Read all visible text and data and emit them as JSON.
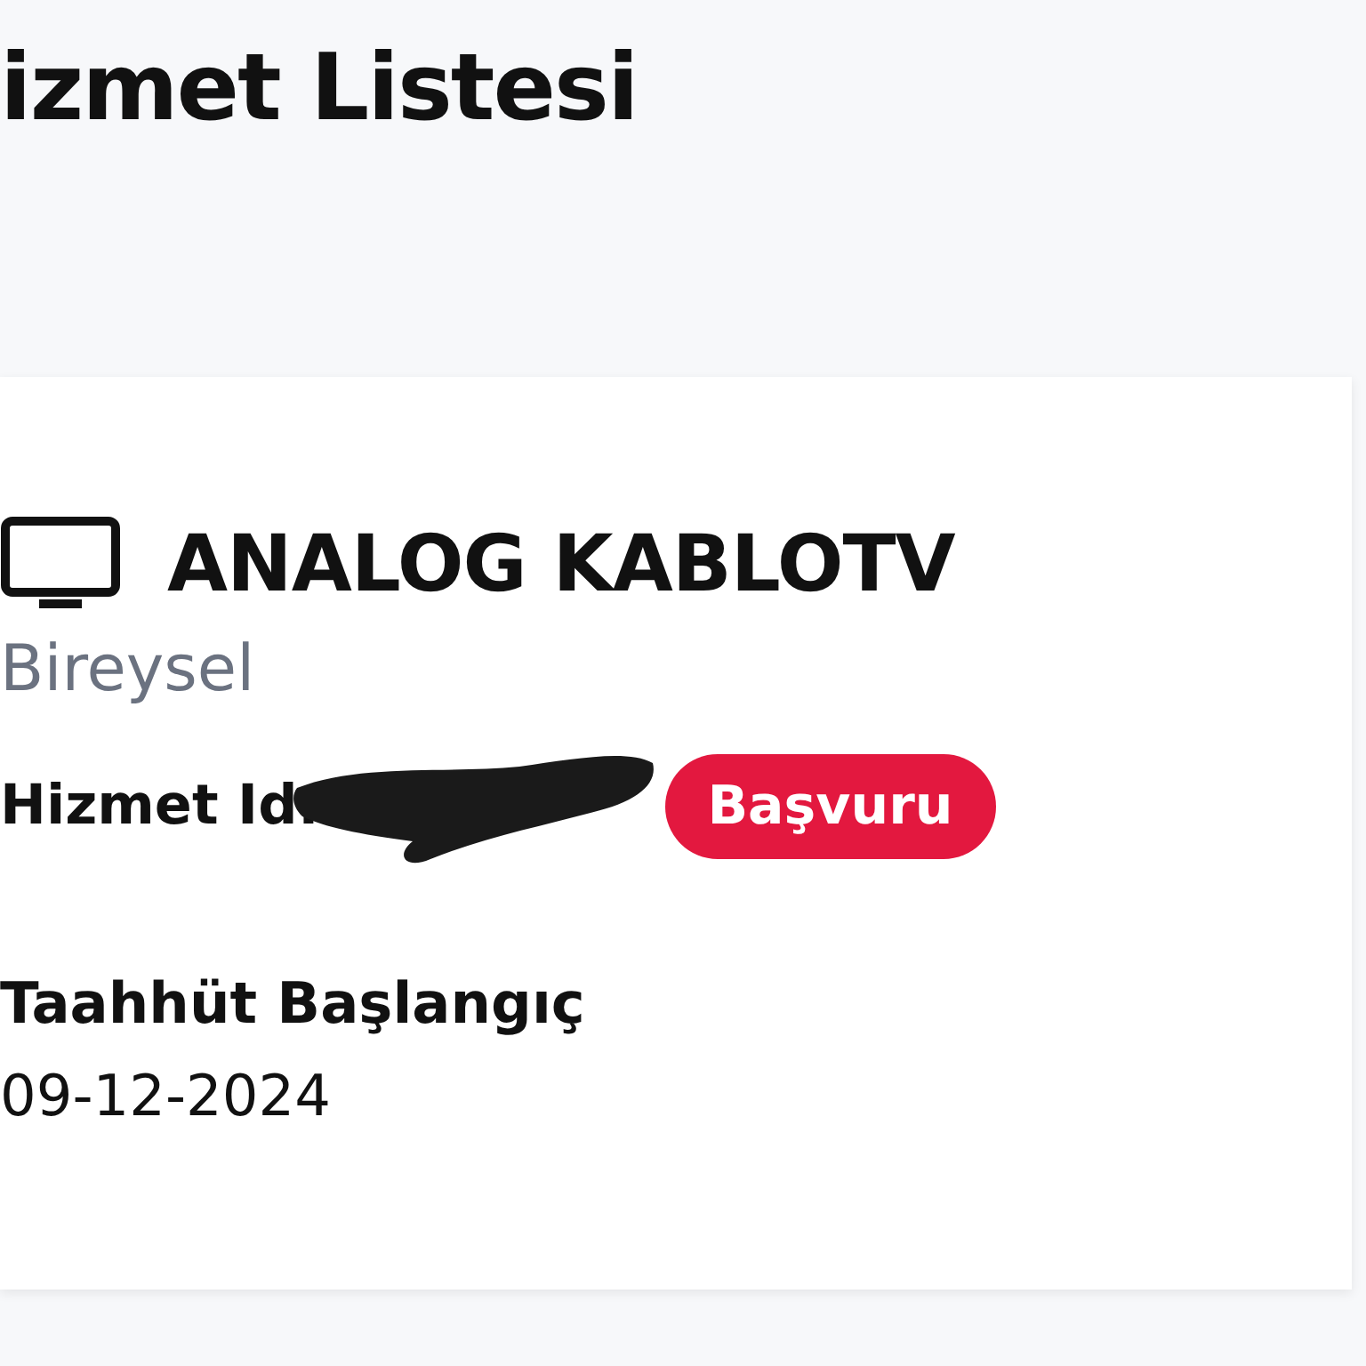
{
  "title": "izmet Listesi",
  "service": {
    "name": "ANALOG KABLOTV",
    "type": "Bireysel",
    "id_label": "Hizmet Id:",
    "status": "Başvuru",
    "commitment_label": "Taahhüt Başlangıç",
    "commitment_date": "09-12-2024"
  }
}
